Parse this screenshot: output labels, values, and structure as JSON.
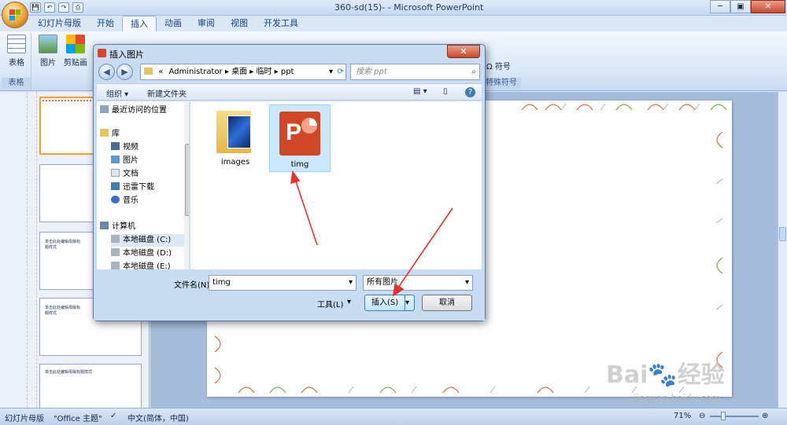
{
  "window": {
    "title": "360-sd(15)- - Microsoft PowerPoint",
    "minimize": "─",
    "maximize": "▣",
    "close": "✕"
  },
  "quick_access": [
    "💾",
    "↶",
    "↷",
    "⎙"
  ],
  "tabs": [
    {
      "label": "幻灯片母版"
    },
    {
      "label": "开始"
    },
    {
      "label": "插入",
      "active": true
    },
    {
      "label": "动画"
    },
    {
      "label": "审阅"
    },
    {
      "label": "视图"
    },
    {
      "label": "开发工具"
    }
  ],
  "ribbon": {
    "table_group": {
      "button": "表格",
      "label": "表格"
    },
    "picture": "图片",
    "clipart": "剪贴画",
    "symbol_group": {
      "symbol": "符号",
      "label": "特殊符号"
    }
  },
  "dialog": {
    "title": "插入图片",
    "close": "✕",
    "address": {
      "prefix": "«",
      "path": [
        "Administrator",
        "桌面",
        "临时",
        "ppt"
      ]
    },
    "search_placeholder": "搜索 ppt",
    "toolbar": {
      "organize": "组织 ▾",
      "new_folder": "新建文件夹"
    },
    "nav": [
      {
        "label": "最近访问的位置",
        "icon": "recent-icon"
      },
      {
        "label": "库",
        "icon": "library-icon"
      },
      {
        "label": "视频",
        "icon": "video-icon"
      },
      {
        "label": "图片",
        "icon": "picture-icon"
      },
      {
        "label": "文档",
        "icon": "document-icon"
      },
      {
        "label": "迅雷下载",
        "icon": "thunder-icon"
      },
      {
        "label": "音乐",
        "icon": "music-icon"
      },
      {
        "label": "计算机",
        "icon": "computer-icon"
      },
      {
        "label": "本地磁盘 (C:)",
        "icon": "drive-icon"
      },
      {
        "label": "本地磁盘 (D:)",
        "icon": "drive-icon"
      },
      {
        "label": "本地磁盘 (E:)",
        "icon": "drive-icon"
      }
    ],
    "files": [
      {
        "name": "images",
        "type": "folder"
      },
      {
        "name": "timg",
        "type": "powerpoint",
        "selected": true
      }
    ],
    "filename_label": "文件名(N):",
    "filename_value": "timg",
    "filetype": "所有图片",
    "tools": "工具(L)",
    "insert": "插入(S)",
    "cancel": "取消"
  },
  "slide_thumbnails": [
    {
      "text": ""
    },
    {
      "text": ""
    },
    {
      "text": "单击此处编辑母版标题样式"
    },
    {
      "text": "单击此处编辑母版标题样式"
    },
    {
      "text": "单击此处编辑母版标题样式"
    }
  ],
  "status": {
    "view": "幻灯片母版",
    "theme": "\"Office 主题\"",
    "language": "中文(简体，中国)",
    "zoom": "71%"
  },
  "watermark": {
    "brand": "Bai",
    "suffix": "经验",
    "url": "jingyan.baidu.com"
  },
  "colors": {
    "accent_orange": "#e86a3a",
    "accent_green": "#6fb24a",
    "arrow_red": "#e83030"
  }
}
